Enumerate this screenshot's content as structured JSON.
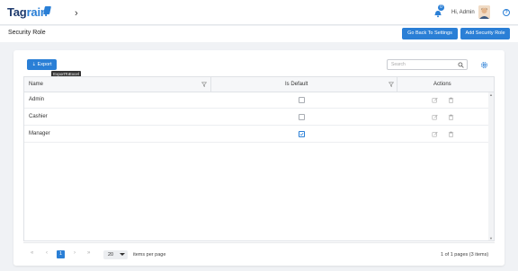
{
  "header": {
    "logo_main": "Tag",
    "logo_accent": "rain",
    "nav_toggle": "›",
    "notification_count": "0",
    "greeting": "Hi, Admin",
    "help": "?"
  },
  "subheader": {
    "title": "Security Role",
    "back_label": "Go Back To Settings",
    "add_label": "Add Security Role"
  },
  "toolbar": {
    "export_label": "⇣ Export",
    "export_tooltip": "ExportToExcel",
    "search_placeholder": "Search"
  },
  "grid": {
    "columns": [
      "Name",
      "Is Default",
      "Actions"
    ],
    "rows": [
      {
        "name": "Admin",
        "is_default": false
      },
      {
        "name": "Cashier",
        "is_default": false
      },
      {
        "name": "Manager",
        "is_default": true
      }
    ]
  },
  "pager": {
    "first": "«",
    "prev": "‹",
    "current_page": "1",
    "next": "›",
    "last": "»",
    "page_size": "20",
    "items_per_page_label": "items per page",
    "info": "1 of 1 pages (3 items)"
  },
  "colors": {
    "accent": "#2a7fd6",
    "brand_dark": "#1f3b6e"
  },
  "icons": [
    "bell-icon",
    "avatar",
    "help-icon",
    "search-icon",
    "gear-icon",
    "filter-icon",
    "edit-icon",
    "delete-icon"
  ]
}
